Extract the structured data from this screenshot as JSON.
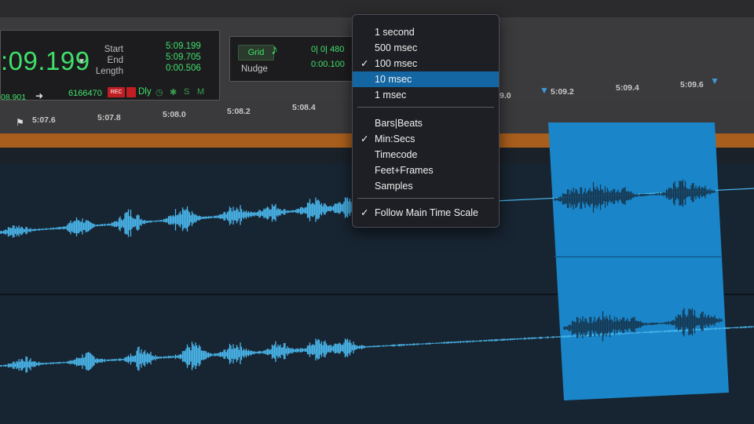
{
  "counter": {
    "main": ":09.199",
    "start_label": "Start",
    "end_label": "End",
    "length_label": "Length",
    "start_value": "5:09.199",
    "end_value": "5:09.705",
    "length_value": "0:00.506",
    "sub_counter": "08.901",
    "sub_samples": "6166470",
    "rec_badge": "REC",
    "dly_label": "Dly",
    "btn_s": "S",
    "btn_m": "M",
    "btn_star": "✱",
    "btn_clock": "◷"
  },
  "grid": {
    "grid_label": "Grid",
    "grid_value": "0| 0| 480",
    "nudge_label": "Nudge",
    "nudge_value": "0:00.100"
  },
  "ruler": {
    "ticks": [
      "5:07.6",
      "5:07.8",
      "5:08.0",
      "5:08.2",
      "5:08.4",
      "9.0",
      "5:09.2",
      "5:09.4",
      "5:09.6"
    ]
  },
  "menu": {
    "group1": [
      {
        "label": "1 second",
        "checked": false,
        "highlighted": false
      },
      {
        "label": "500 msec",
        "checked": false,
        "highlighted": false
      },
      {
        "label": "100 msec",
        "checked": true,
        "highlighted": false
      },
      {
        "label": "10 msec",
        "checked": false,
        "highlighted": true
      },
      {
        "label": "1 msec",
        "checked": false,
        "highlighted": false
      }
    ],
    "group2": [
      {
        "label": "Bars|Beats",
        "checked": false
      },
      {
        "label": "Min:Secs",
        "checked": true
      },
      {
        "label": "Timecode",
        "checked": false
      },
      {
        "label": "Feet+Frames",
        "checked": false
      },
      {
        "label": "Samples",
        "checked": false
      }
    ],
    "group3": [
      {
        "label": "Follow Main Time Scale",
        "checked": true
      }
    ],
    "check_glyph": "✓"
  },
  "colors": {
    "counter_green": "#3fe06a",
    "waveform": "#4ab8ee",
    "selection": "#1a86c9",
    "highlight": "#1466a3",
    "ruler_orange": "#a85e1c"
  }
}
